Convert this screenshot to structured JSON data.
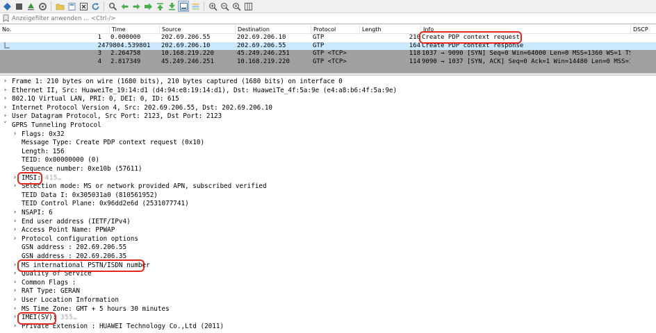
{
  "filter": {
    "placeholder": "Anzeigefilter anwenden ... <Ctrl-/>"
  },
  "columns": {
    "no": "No.",
    "time": "Time",
    "source": "Source",
    "destination": "Destination",
    "protocol": "Protocol",
    "length": "Length",
    "info": "Info",
    "dscp": "DSCP"
  },
  "packets": [
    {
      "no": "1",
      "time": "0.000000",
      "source": "202.69.206.55",
      "destination": "202.69.206.10",
      "protocol": "GTP",
      "length": "210",
      "info": "Create PDP context request"
    },
    {
      "no": "2",
      "time": "479804.539801",
      "source": "202.69.206.10",
      "destination": "202.69.206.55",
      "protocol": "GTP",
      "length": "164",
      "info": "Create PDP context response"
    },
    {
      "no": "3",
      "time": "2.264758",
      "source": "10.168.219.220",
      "destination": "45.249.246.251",
      "protocol": "GTP <TCP>",
      "length": "118",
      "info": "1037 → 9090 [SYN] Seq=0 Win=64000 Len=0 MSS=1360 WS=1 TS…"
    },
    {
      "no": "4",
      "time": "2.817349",
      "source": "45.249.246.251",
      "destination": "10.168.219.220",
      "protocol": "GTP <TCP>",
      "length": "114",
      "info": "9090 → 1037 [SYN, ACK] Seq=0 Ack=1 Win=14480 Len=0 MSS=1…"
    }
  ],
  "colors": {
    "selected_row": "#cce8ff",
    "gray_row": "#a0a0a0",
    "highlight_red": "#e4261d"
  },
  "tree": {
    "frame": "Frame 1: 210 bytes on wire (1680 bits), 210 bytes captured (1680 bits) on interface 0",
    "ethernet": "Ethernet II, Src: HuaweiTe_19:14:d1 (d4:94:e8:19:14:d1), Dst: HuaweiTe_4f:5a:9e (e4:a8:b6:4f:5a:9e)",
    "vlan": "802.1Q Virtual LAN, PRI: 0, DEI: 0, ID: 615",
    "ip": "Internet Protocol Version 4, Src: 202.69.206.55, Dst: 202.69.206.10",
    "udp": "User Datagram Protocol, Src Port: 2123, Dst Port: 2123",
    "gtp": "GPRS Tunneling Protocol",
    "flags": "Flags: 0x32",
    "message_type": "Message Type: Create PDP context request (0x10)",
    "length": "Length: 156",
    "teid": "TEID: 0x00000000 (0)",
    "sequence": "Sequence number: 0xe10b (57611)",
    "imsi_label": "IMSI:",
    "imsi_value": "415…",
    "selection_mode": "Selection mode: MS or network provided APN, subscribed verified",
    "teid_data": "TEID Data I: 0x305031a0 (810561952)",
    "teid_control": "TEID Control Plane: 0x96dd2e6d (2531077741)",
    "nsapi": "NSAPI: 6",
    "end_user": "End user address (IETF/IPv4)",
    "apn": "Access Point Name: PPWAP",
    "pco": "Protocol configuration options",
    "gsn1": "GSN address : 202.69.206.55",
    "gsn2": "GSN address : 202.69.206.35",
    "msisdn": "MS international PSTN/ISDN number",
    "qos": "Quality of Service",
    "common_flags": "Common Flags :",
    "rat": "RAT Type: GERAN",
    "uli": "User Location Information",
    "timezone": "MS Time Zone: GMT + 5 hours 30 minutes",
    "imei_label": "IMEI(SV):",
    "imei_value": "355…",
    "private_ext": "Private Extension : HUAWEI Technology Co.,Ltd (2011)"
  }
}
